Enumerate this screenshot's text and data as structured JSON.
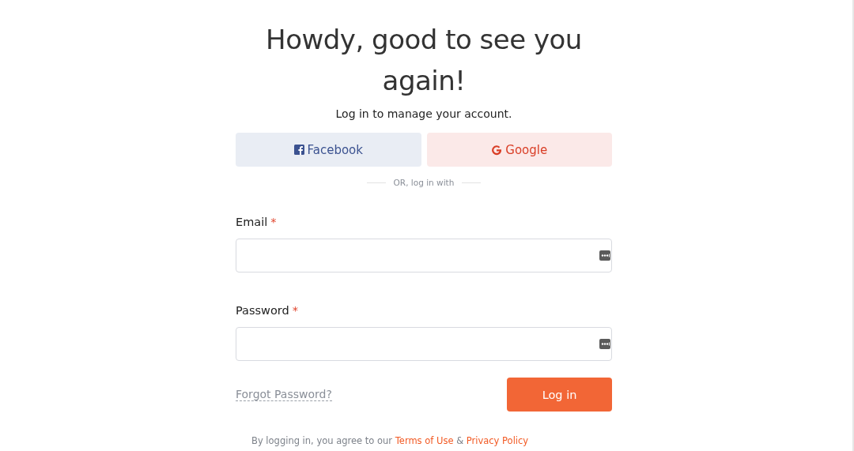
{
  "heading": "Howdy, good to see you again!",
  "subtitle": "Log in to manage your account.",
  "social_buttons": [
    {
      "kind": "facebook",
      "label": "Facebook"
    },
    {
      "kind": "google",
      "label": "Google"
    }
  ],
  "divider": "OR, log in with",
  "fields": [
    {
      "label": "Email",
      "required_mark": "*"
    },
    {
      "label": "Password",
      "required_mark": "*"
    }
  ],
  "forgot_link": "Forgot Password?",
  "login_button": "Log in",
  "legal": {
    "prefix": "By logging in, you agree to our",
    "terms": "Terms of Use",
    "separator": "&",
    "privacy": "Privacy Policy"
  }
}
